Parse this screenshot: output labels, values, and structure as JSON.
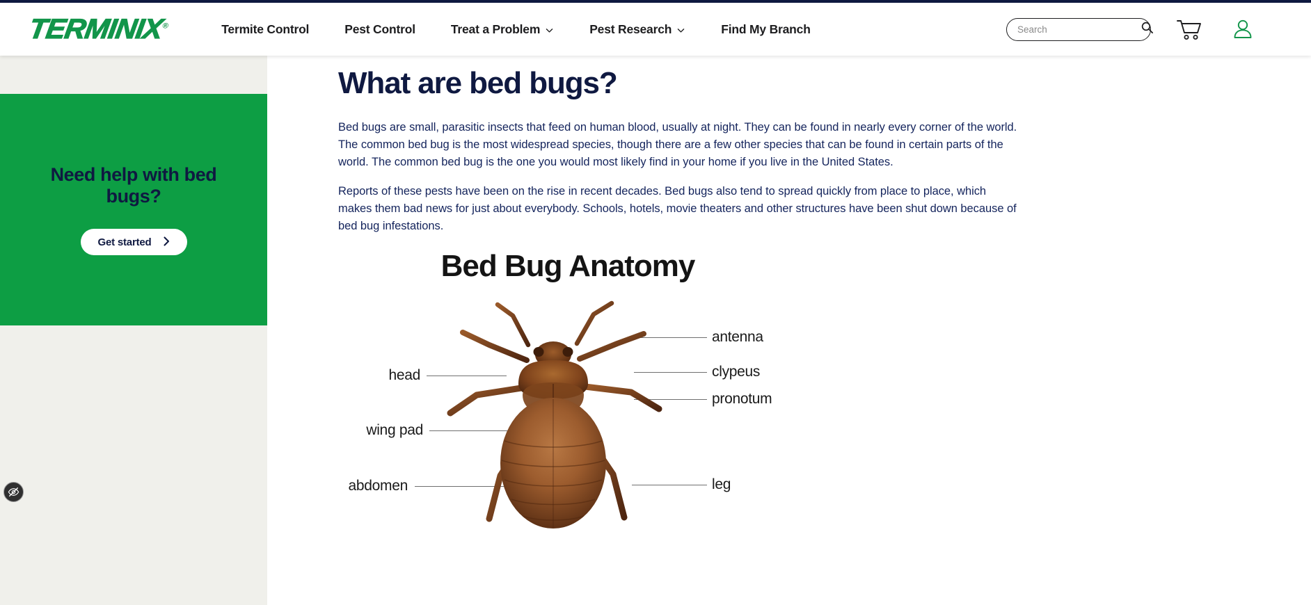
{
  "browser": {
    "chrome_strip_color": "#0f1941"
  },
  "header": {
    "logo_text": "TERMINIX",
    "logo_mark": "®",
    "logo_color": "#12954a",
    "nav": [
      {
        "label": "Termite Control",
        "has_dropdown": false
      },
      {
        "label": "Pest Control",
        "has_dropdown": false
      },
      {
        "label": "Treat a Problem",
        "has_dropdown": true
      },
      {
        "label": "Pest Research",
        "has_dropdown": true
      },
      {
        "label": "Find My Branch",
        "has_dropdown": false
      }
    ],
    "search": {
      "placeholder": "Search",
      "value": "",
      "icon": "search-icon"
    },
    "cart_icon": "shopping-cart-icon",
    "account_icon": "user-account-icon",
    "account_icon_color": "#12954a"
  },
  "sidebar": {
    "background_color": "#f0f0eb",
    "promo": {
      "background_color": "#0d9e44",
      "title": "Need help with bed bugs?",
      "button_label": "Get started",
      "button_arrow": "›",
      "text_color": "#0f1941"
    },
    "accessibility_widget": {
      "icon": "accessibility-eye-slash-icon",
      "label": ""
    }
  },
  "main": {
    "title": "What are bed bugs?",
    "title_color": "#0f1941",
    "paragraphs": [
      "Bed bugs are small, parasitic insects that feed on human blood, usually at night. They can be found in nearly every corner of the world. The common bed bug is the most widespread species, though there are a few other species that can be found in certain parts of the world. The common bed bug is the one you would most likely find in your home if you live in the United States.",
      "Reports of these pests have been on the rise in recent decades. Bed bugs also tend to spread quickly from place to place, which makes them bad news for just about everybody. Schools, hotels, movie theaters and other structures have been shut down because of bed bug infestations."
    ],
    "figure": {
      "title": "Bed Bug Anatomy",
      "alt": "bed-bug-anatomy-diagram",
      "labels_right": [
        {
          "text": "antenna"
        },
        {
          "text": "clypeus"
        },
        {
          "text": "pronotum"
        },
        {
          "text": "leg"
        }
      ],
      "labels_left": [
        {
          "text": "head"
        },
        {
          "text": "wing pad"
        },
        {
          "text": "abdomen"
        }
      ]
    }
  }
}
